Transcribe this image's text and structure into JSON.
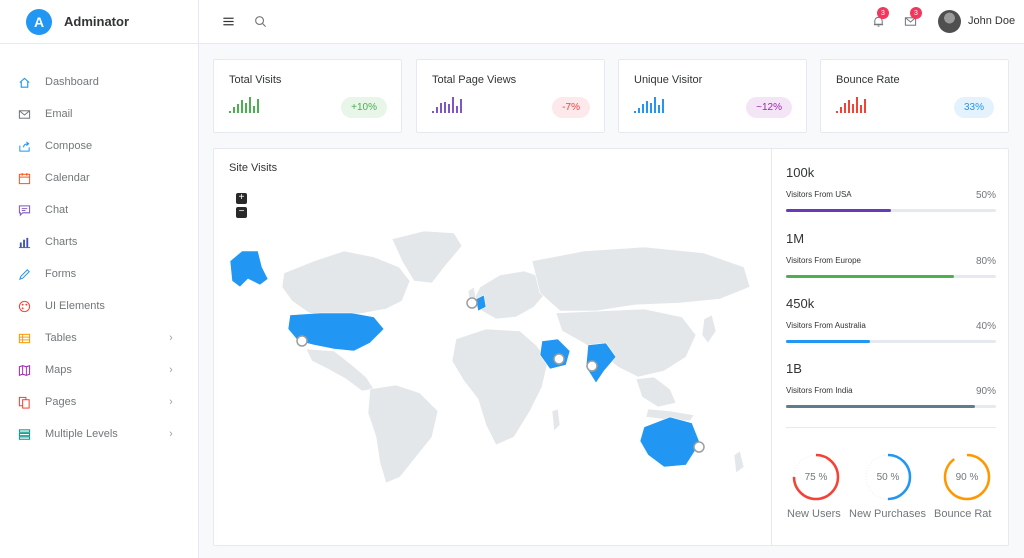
{
  "brand": {
    "name": "Adminator",
    "logo_letter": "A"
  },
  "sidebar": {
    "items": [
      {
        "label": "Dashboard",
        "icon": "home-icon",
        "color": "#2196f3",
        "has_children": false
      },
      {
        "label": "Email",
        "icon": "mail-icon",
        "color": "#72777a",
        "has_children": false
      },
      {
        "label": "Compose",
        "icon": "share-icon",
        "color": "#2196f3",
        "has_children": false
      },
      {
        "label": "Calendar",
        "icon": "calendar-icon",
        "color": "#ff5722",
        "has_children": false
      },
      {
        "label": "Chat",
        "icon": "chat-icon",
        "color": "#7e57c2",
        "has_children": false
      },
      {
        "label": "Charts",
        "icon": "bar-chart-icon",
        "color": "#3f51b5",
        "has_children": false
      },
      {
        "label": "Forms",
        "icon": "pencil-icon",
        "color": "#2196f3",
        "has_children": false
      },
      {
        "label": "UI Elements",
        "icon": "palette-icon",
        "color": "#f44336",
        "has_children": false
      },
      {
        "label": "Tables",
        "icon": "table-icon",
        "color": "#ff9800",
        "has_children": true
      },
      {
        "label": "Maps",
        "icon": "map-icon",
        "color": "#9c27b0",
        "has_children": true
      },
      {
        "label": "Pages",
        "icon": "files-icon",
        "color": "#f44336",
        "has_children": true
      },
      {
        "label": "Multiple Levels",
        "icon": "layers-icon",
        "color": "#009688",
        "has_children": true
      }
    ]
  },
  "header": {
    "notifications_count": "3",
    "messages_count": "3",
    "user_name": "John Doe"
  },
  "stats": [
    {
      "title": "Total Visits",
      "badge": "+10%",
      "color": "#4caf50",
      "badge_bg": "#e8f5e9",
      "bars": [
        0.15,
        0.35,
        0.55,
        0.8,
        0.6,
        1.0,
        0.45,
        0.9
      ]
    },
    {
      "title": "Total Page Views",
      "badge": "-7%",
      "color": "#7e57c2",
      "badge_bg": "#fde8ec",
      "badge_color": "#f44336",
      "bars": [
        0.15,
        0.35,
        0.6,
        0.7,
        0.55,
        1.0,
        0.45,
        0.85
      ]
    },
    {
      "title": "Unique Visitor",
      "badge": "~12%",
      "color": "#2196f3",
      "badge_bg": "#f3e5f5",
      "badge_color": "#9c27b0",
      "bars": [
        0.15,
        0.3,
        0.55,
        0.75,
        0.6,
        1.0,
        0.5,
        0.9
      ]
    },
    {
      "title": "Bounce Rate",
      "badge": "33%",
      "color": "#f44336",
      "badge_bg": "#e3f2fd",
      "badge_color": "#2196f3",
      "bars": [
        0.15,
        0.35,
        0.6,
        0.8,
        0.55,
        1.0,
        0.5,
        0.85
      ]
    }
  ],
  "site_visits": {
    "title": "Site Visits",
    "zoom_in": "+",
    "zoom_out": "−",
    "visitors": [
      {
        "value": "100k",
        "label": "Visitors From USA",
        "percent": "50%",
        "fraction": 0.5,
        "color": "#673ab7"
      },
      {
        "value": "1M",
        "label": "Visitors From Europe",
        "percent": "80%",
        "fraction": 0.8,
        "color": "#4caf50"
      },
      {
        "value": "450k",
        "label": "Visitors From Australia",
        "percent": "40%",
        "fraction": 0.4,
        "color": "#2196f3"
      },
      {
        "value": "1B",
        "label": "Visitors From India",
        "percent": "90%",
        "fraction": 0.9,
        "color": "#607d8b"
      }
    ],
    "donuts": [
      {
        "label": "75 %",
        "caption": "New Users",
        "fraction": 0.75,
        "color": "#f44336"
      },
      {
        "label": "50 %",
        "caption": "New Purchases",
        "fraction": 0.5,
        "color": "#2196f3"
      },
      {
        "label": "90 %",
        "caption": "Bounce Rat",
        "fraction": 0.9,
        "color": "#ff9800"
      }
    ]
  }
}
